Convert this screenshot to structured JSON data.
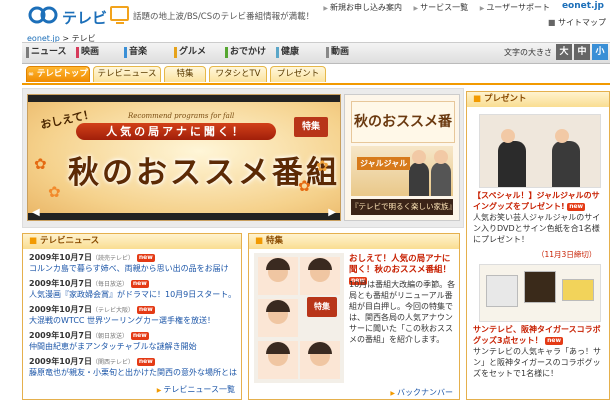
{
  "header": {
    "logo_text": "テレビ",
    "tagline": "話題の地上波/BS/CSのテレビ番組情報が満載！",
    "top_links": [
      "新規お申し込み案内",
      "サービス一覧",
      "ユーザーサポート"
    ],
    "site_name": "eonet.jp",
    "sitemap": "サイトマップ"
  },
  "breadcrumb": {
    "home": "eonet.jp",
    "separator": " > ",
    "current": "テレビ"
  },
  "categories": [
    {
      "label": "ニュース",
      "color": "#7c7c7c"
    },
    {
      "label": "映画",
      "color": "#d63a5a"
    },
    {
      "label": "音楽",
      "color": "#3a8fd6"
    },
    {
      "label": "グルメ",
      "color": "#e6a21a"
    },
    {
      "label": "おでかけ",
      "color": "#55a630"
    },
    {
      "label": "健康",
      "color": "#5aa6c8"
    },
    {
      "label": "動画",
      "color": "#888888"
    }
  ],
  "text_size": {
    "label": "文字の大きさ",
    "buttons": [
      "大",
      "中",
      "小"
    ],
    "selected": "小",
    "accent": "#3a8fd6"
  },
  "tabs": [
    {
      "label": "テレビトップ",
      "active": true
    },
    {
      "label": "テレビニュース",
      "active": false
    },
    {
      "label": "特集",
      "active": false
    },
    {
      "label": "ワタシとTV",
      "active": false
    },
    {
      "label": "プレゼント",
      "active": false
    }
  ],
  "feature": {
    "oshiete": "おしえて！",
    "recommend": "Recommend programs for fall",
    "pill": "人気の局アナに聞く！",
    "title": "秋のおススメ番組",
    "badge": "特集",
    "side_title": "秋のおススメ番組",
    "side_brand": "ジャルジャル",
    "side_foot": "『テレビで明るく楽しい家族』"
  },
  "present": {
    "heading": "プレゼント",
    "items": [
      {
        "title": "【スペシャル！】ジャルジャルのサイングッズをプレゼント!",
        "body": "人気お笑い芸人ジャルジャルのサイン入りDVDとサイン色紙を合1名様にプレゼント！",
        "deadline": "（11月3日締切）"
      },
      {
        "title": "サンテレビ、阪神タイガースコラボグッズ3点セット！",
        "body": "サンテレビの人気キャラ「あっ！サン」と阪神タイガースのコラボグッズをセットで1名様に！"
      }
    ],
    "new_label": "new"
  },
  "news": {
    "heading": "テレビニュース",
    "items": [
      {
        "date": "2009年10月7日",
        "source": "（読売テレビ）",
        "text": "コルンカ島で暮らす姉べ、両親から思い出の品をお届け"
      },
      {
        "date": "2009年10月7日",
        "source": "（毎日放送）",
        "text": "人気漫画『家政婦会賞』がドラマに！10月9日スタート。"
      },
      {
        "date": "2009年10月7日",
        "source": "（テレビ大阪）",
        "text": "大混戦のWTCC 世界ツーリングカー選手権を放送！"
      },
      {
        "date": "2009年10月7日",
        "source": "（朝日放送）",
        "text": "仲間由紀恵がまアンタッチャブルな謎解き開始"
      },
      {
        "date": "2009年10月7日",
        "source": "（関西テレビ）",
        "text": "藤原竜也が親友・小栗旬と出かけた関西の意外な場所とは？"
      }
    ],
    "new_label": "new",
    "more": "テレビニュース一覧"
  },
  "special": {
    "heading": "特集",
    "badge": "特集",
    "title": "おしえて！人気の局アナに聞く！秋のおススメ番組！",
    "new_label": "new",
    "body": "10月は番組大改編の季節。各局とも番組がリニューアル番組が目白押し。今回の特集では、関西各局の人気アナウンサーに聞いた「この秋おススメの番組」を紹介します。",
    "more": "バックナンバー"
  }
}
